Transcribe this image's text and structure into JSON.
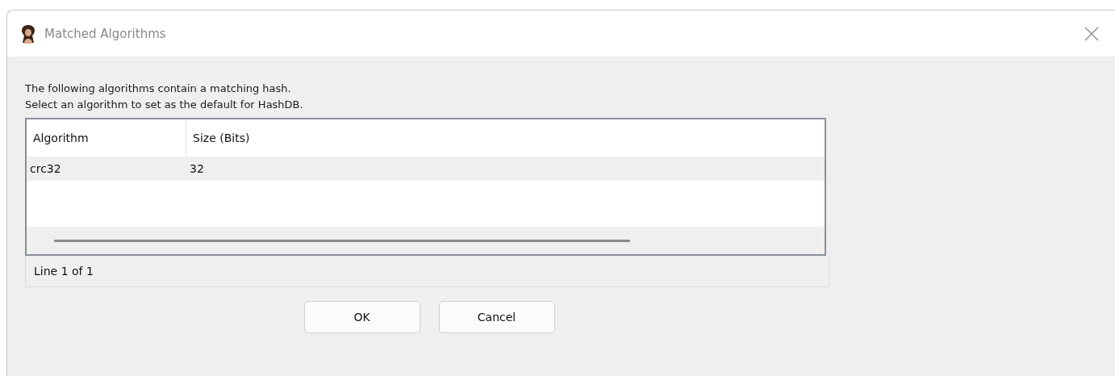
{
  "window": {
    "title": "Matched Algorithms"
  },
  "message": [
    "The following algorithms contain a matching hash.",
    "Select an algorithm to set as the default for HashDB."
  ],
  "table": {
    "columns": [
      "Algorithm",
      "Size (Bits)"
    ],
    "rows": [
      [
        "crc32",
        "32"
      ]
    ]
  },
  "status_bar": "Line 1 of 1",
  "buttons": [
    "OK",
    "Cancel"
  ]
}
